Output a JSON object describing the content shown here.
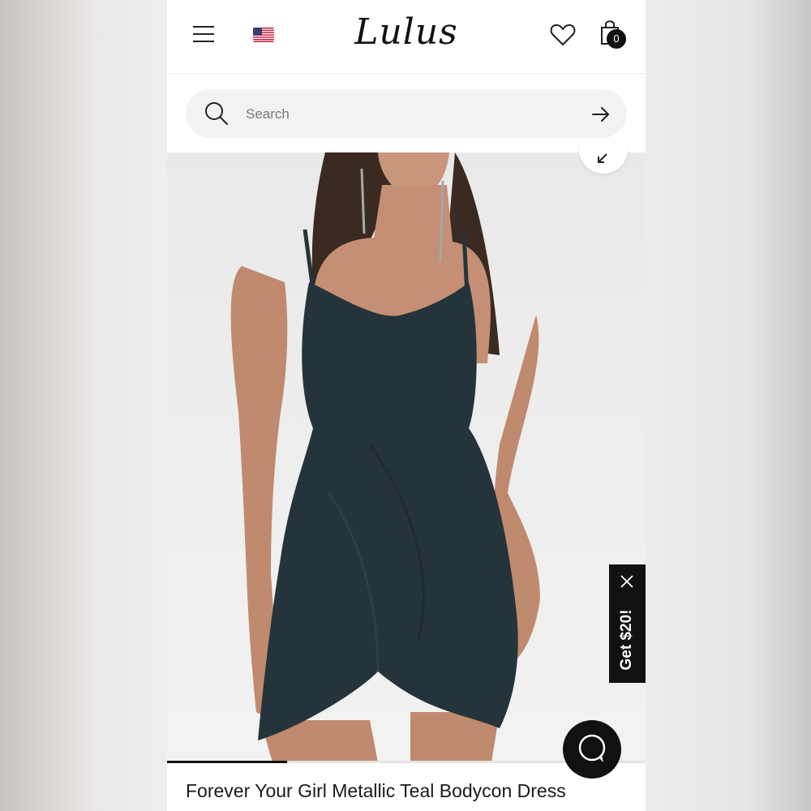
{
  "header": {
    "logo_text": "Lulus",
    "menu_icon": "hamburger-menu-icon",
    "flag_icon": "us-flag-icon",
    "wishlist_icon": "heart-icon",
    "cart_icon": "shopping-bag-icon",
    "cart_count": "0"
  },
  "search": {
    "placeholder": "Search",
    "value": "",
    "search_icon": "search-icon",
    "submit_icon": "arrow-right-icon"
  },
  "gallery": {
    "image_description_icon": "product-photo",
    "collapse_icon": "collapse-arrow-icon",
    "progress_fraction": 0.25
  },
  "promo": {
    "label": "Get $20!",
    "close_icon": "close-icon"
  },
  "chat": {
    "icon": "chat-bubble-icon"
  },
  "product": {
    "title": "Forever Your Girl Metallic Teal Bodycon Dress"
  },
  "colors": {
    "accent": "#111111",
    "dress": "#24343a",
    "search_bg": "#f2f2f2"
  }
}
